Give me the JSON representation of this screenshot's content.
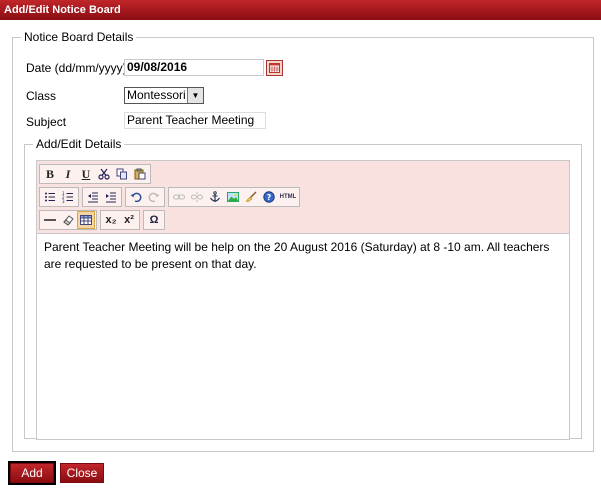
{
  "window": {
    "title": "Add/Edit Notice Board"
  },
  "details": {
    "legend": "Notice Board Details",
    "date_label": "Date (dd/mm/yyyy)*",
    "date_value": "09/08/2016",
    "class_label": "Class",
    "class_value": "Montessori",
    "subject_label": "Subject",
    "subject_value": "Parent Teacher Meeting"
  },
  "editor": {
    "legend": "Add/Edit Details",
    "content": "Parent Teacher Meeting will be help on the 20 August 2016 (Saturday) at 8 -10 am. All teachers are requested to be present on that day.",
    "toolbar": {
      "bold": "B",
      "italic": "I",
      "underline": "U",
      "html": "HTML",
      "subscript": "x₂",
      "superscript": "x²",
      "omega": "Ω"
    }
  },
  "actions": {
    "add_label": "Add",
    "close_label": "Close"
  }
}
